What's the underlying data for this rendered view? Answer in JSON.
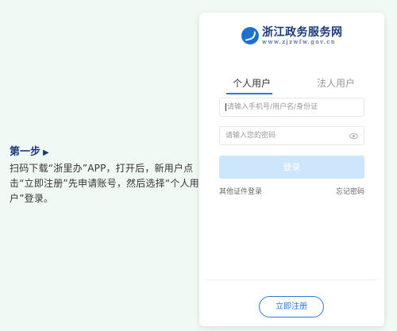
{
  "instruction": {
    "step_title": "第一步",
    "step_arrow": "▶",
    "body": "扫码下载“浙里办”APP，打开后，新用户点击“立即注册”先申请账号，然后选择“个人用户”登录。"
  },
  "login": {
    "logo_title": "浙江政务服务网",
    "logo_url": "www.zjzwfw.gov.cn",
    "tabs": [
      {
        "label": "个人用户",
        "active": true
      },
      {
        "label": "法人用户",
        "active": false
      }
    ],
    "account_placeholder": "请输入手机号/用户名/身份证",
    "password_placeholder": "请输入您的密码",
    "login_button": "登录",
    "other_cert_login": "其他证件登录",
    "forgot_password": "忘记密码",
    "register_button": "立即注册"
  },
  "colors": {
    "accent": "#2a7ae2",
    "page_background": "#f1f9f4",
    "login_button_disabled": "#cde6fb",
    "title_blue": "#1a3a7c"
  },
  "icons": {
    "logo": "zhejiang-gov-logo-icon",
    "password_toggle": "eye-icon"
  }
}
